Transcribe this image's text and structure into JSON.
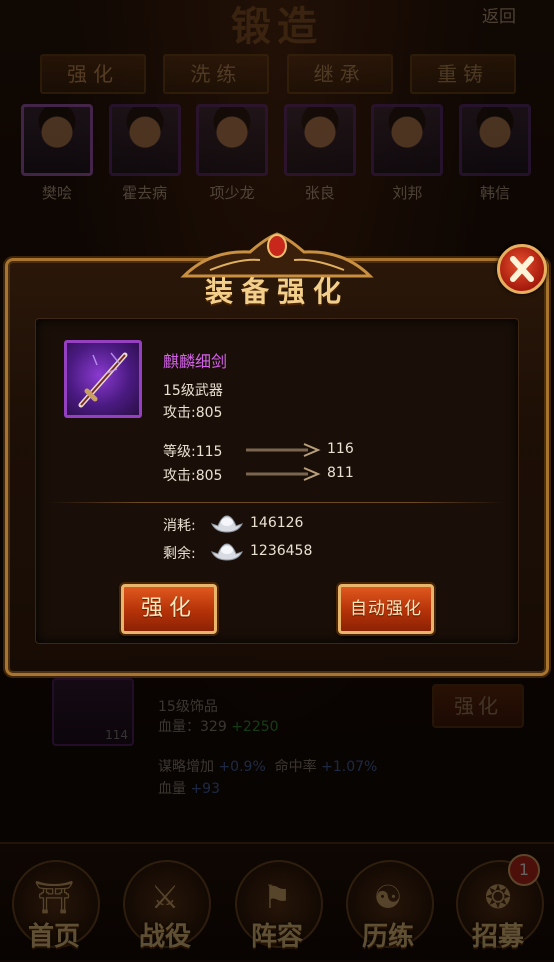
{
  "header": {
    "title": "锻造",
    "back_label": "返回"
  },
  "tabs": [
    {
      "label": "强化",
      "active": true
    },
    {
      "label": "洗练",
      "active": false
    },
    {
      "label": "继承",
      "active": false
    },
    {
      "label": "重铸",
      "active": false
    }
  ],
  "heroes": [
    {
      "name": "樊哙",
      "selected": true
    },
    {
      "name": "霍去病",
      "selected": false
    },
    {
      "name": "项少龙",
      "selected": false
    },
    {
      "name": "张良",
      "selected": false
    },
    {
      "name": "刘邦",
      "selected": false
    },
    {
      "name": "韩信",
      "selected": false
    }
  ],
  "modal": {
    "title": "装备强化",
    "close_icon": "close-x-icon",
    "item": {
      "name": "麒麟细剑",
      "name_color": "#d262e8",
      "level_type": "15级武器",
      "attack": "攻击:805",
      "icon": "sword-icon"
    },
    "level_row": {
      "label": "等级:115",
      "next": "116"
    },
    "attack_row": {
      "label": "攻击:805",
      "next": "811"
    },
    "cost": {
      "label": "消耗:",
      "value": "146126",
      "icon": "silver-ingot-icon"
    },
    "remain": {
      "label": "剩余:",
      "value": "1236458",
      "icon": "silver-ingot-icon"
    },
    "strengthen_button": "强化",
    "auto_strengthen_button": "自动强化"
  },
  "background_item": {
    "count": "114",
    "level_type": "15级饰品",
    "hp_label": "血量：329",
    "hp_bonus": "+2250",
    "strategy_label": "谋略增加",
    "strategy_value": "+0.9%",
    "hit_label": "命中率",
    "hit_value": "+1.07%",
    "hp2_label": "血量",
    "hp2_value": "+93",
    "button": "强化"
  },
  "nav": [
    {
      "label": "首页",
      "icon": "palace-icon"
    },
    {
      "label": "战役",
      "icon": "crossed-swords-icon"
    },
    {
      "label": "阵容",
      "icon": "banner-icon"
    },
    {
      "label": "历练",
      "icon": "yin-yang-icon"
    },
    {
      "label": "招募",
      "icon": "recruit-icon",
      "badge": "1"
    }
  ],
  "colors": {
    "accent_gold": "#f3cf8c",
    "purple_rarity": "#d262e8",
    "button_red": "#b43208",
    "bonus_green": "#3fc34a",
    "bonus_blue": "#5b86e0"
  }
}
